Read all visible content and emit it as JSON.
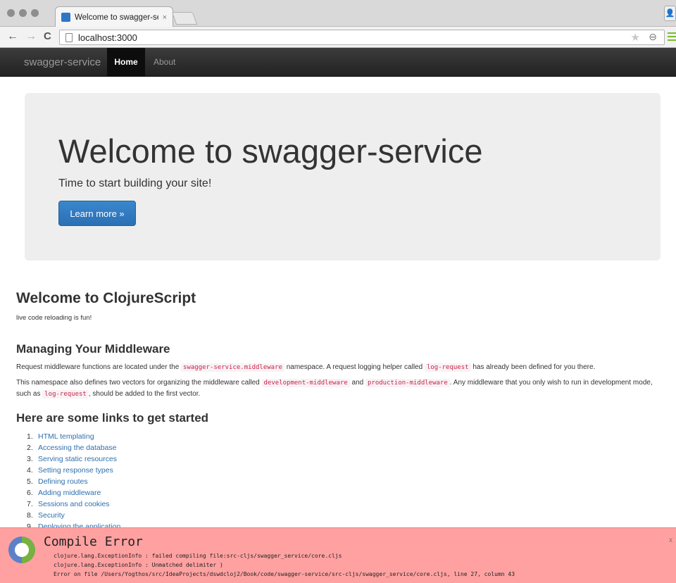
{
  "browser": {
    "tab_title": "Welcome to swagger-servi",
    "tab_close": "×",
    "url": "localhost:3000",
    "back": "←",
    "forward": "→",
    "reload": "C",
    "star": "★",
    "zoom": "⊖",
    "profile_icon": "person-icon"
  },
  "navbar": {
    "brand": "swagger-service",
    "home": "Home",
    "about": "About"
  },
  "jumbotron": {
    "title": "Welcome to swagger-service",
    "lead": "Time to start building your site!",
    "button": "Learn more »"
  },
  "content": {
    "cljs_title": "Welcome to ClojureScript",
    "cljs_text": "live code reloading is fun!",
    "middleware_title": "Managing Your Middleware",
    "para1": {
      "t1": "Request middleware functions are located under the ",
      "c1": "swagger-service.middleware",
      "t2": " namespace. A request logging helper called ",
      "c2": "log-request",
      "t3": " has already been defined for you there."
    },
    "para2": {
      "t1": "This namespace also defines two vectors for organizing the middleware called ",
      "c1": "development-middleware",
      "t2": " and ",
      "c2": "production-middleware",
      "t3": ". Any middleware that you only wish to run in development mode, such as ",
      "c3": "log-request",
      "t4": ", should be added to the first vector."
    },
    "links_title": "Here are some links to get started",
    "links": [
      {
        "num": "1.",
        "label": "HTML templating"
      },
      {
        "num": "2.",
        "label": "Accessing the database"
      },
      {
        "num": "3.",
        "label": "Serving static resources"
      },
      {
        "num": "4.",
        "label": "Setting response types"
      },
      {
        "num": "5.",
        "label": "Defining routes"
      },
      {
        "num": "6.",
        "label": "Adding middleware"
      },
      {
        "num": "7.",
        "label": "Sessions and cookies"
      },
      {
        "num": "8.",
        "label": "Security"
      },
      {
        "num": "9.",
        "label": "Deploying the application"
      }
    ]
  },
  "error": {
    "title": "Compile Error",
    "close": "x",
    "lines": [
      "clojure.lang.ExceptionInfo : failed compiling file:src-cljs/swagger_service/core.cljs",
      "clojure.lang.ExceptionInfo : Unmatched delimiter )",
      "Error on file /Users/Yogthos/src/IdeaProjects/dswdcloj2/Book/code/swagger-service/src-cljs/swagger_service/core.cljs, line 27, column 43"
    ]
  }
}
